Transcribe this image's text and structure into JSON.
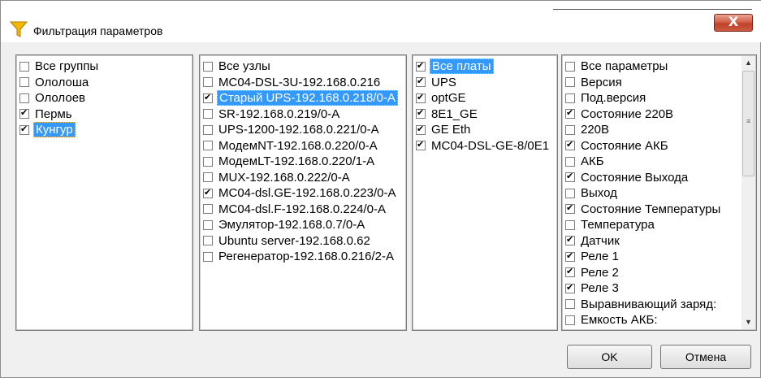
{
  "window": {
    "title": "Фильтрация параметров",
    "close_label": "X"
  },
  "groups": [
    {
      "label": "Все группы",
      "checked": false,
      "selected": false
    },
    {
      "label": "Олoлоша",
      "checked": false,
      "selected": false
    },
    {
      "label": "Ололоев",
      "checked": false,
      "selected": false
    },
    {
      "label": "Пермь",
      "checked": true,
      "selected": false
    },
    {
      "label": "Кунгур",
      "checked": true,
      "selected": true
    }
  ],
  "nodes": [
    {
      "label": "Все узлы",
      "checked": false,
      "selected": false
    },
    {
      "label": "MC04-DSL-3U-192.168.0.216",
      "checked": false,
      "selected": false
    },
    {
      "label": "Старый UPS-192.168.0.218/0-А",
      "checked": true,
      "selected": true
    },
    {
      "label": "SR-192.168.0.219/0-А",
      "checked": false,
      "selected": false
    },
    {
      "label": "UPS-1200-192.168.0.221/0-А",
      "checked": false,
      "selected": false
    },
    {
      "label": "МодемNT-192.168.0.220/0-А",
      "checked": false,
      "selected": false
    },
    {
      "label": "МодемLT-192.168.0.220/1-А",
      "checked": false,
      "selected": false
    },
    {
      "label": "MUX-192.168.0.222/0-А",
      "checked": false,
      "selected": false
    },
    {
      "label": "MC04-dsl.GE-192.168.0.223/0-А",
      "checked": true,
      "selected": false
    },
    {
      "label": "MC04-dsl.F-192.168.0.224/0-А",
      "checked": false,
      "selected": false
    },
    {
      "label": "Эмулятор-192.168.0.7/0-А",
      "checked": false,
      "selected": false
    },
    {
      "label": "Ubuntu server-192.168.0.62",
      "checked": false,
      "selected": false
    },
    {
      "label": "Регенератор-192.168.0.216/2-А",
      "checked": false,
      "selected": false
    }
  ],
  "boards": [
    {
      "label": "Все платы",
      "checked": true,
      "selected": true
    },
    {
      "label": "UPS",
      "checked": true,
      "selected": false
    },
    {
      "label": "optGE",
      "checked": true,
      "selected": false
    },
    {
      "label": "8E1_GE",
      "checked": true,
      "selected": false
    },
    {
      "label": "GE Eth",
      "checked": true,
      "selected": false
    },
    {
      "label": "MC04-DSL-GE-8/0E1",
      "checked": true,
      "selected": false
    }
  ],
  "params": [
    {
      "label": "Все параметры",
      "checked": false,
      "selected": false
    },
    {
      "label": "Версия",
      "checked": false,
      "selected": false
    },
    {
      "label": "Под.версия",
      "checked": false,
      "selected": false
    },
    {
      "label": "Состояние 220В",
      "checked": true,
      "selected": false
    },
    {
      "label": "220В",
      "checked": false,
      "selected": false
    },
    {
      "label": "Состояние АКБ",
      "checked": true,
      "selected": false
    },
    {
      "label": "АКБ",
      "checked": false,
      "selected": false
    },
    {
      "label": "Состояние Выхода",
      "checked": true,
      "selected": false
    },
    {
      "label": "Выход",
      "checked": false,
      "selected": false
    },
    {
      "label": "Состояние Температуры",
      "checked": true,
      "selected": false
    },
    {
      "label": "Температура",
      "checked": false,
      "selected": false
    },
    {
      "label": "Датчик",
      "checked": true,
      "selected": false
    },
    {
      "label": "Реле 1",
      "checked": true,
      "selected": false
    },
    {
      "label": "Реле 2",
      "checked": true,
      "selected": false
    },
    {
      "label": "Реле 3",
      "checked": true,
      "selected": false
    },
    {
      "label": "Выравнивающий заряд:",
      "checked": false,
      "selected": false
    },
    {
      "label": "Емкость АКБ:",
      "checked": false,
      "selected": false
    }
  ],
  "buttons": {
    "ok": "OK",
    "cancel": "Отмена"
  },
  "colors": {
    "selection": "#3399ff",
    "close_button": "#c8472d",
    "filter_icon": "#f5b800"
  }
}
